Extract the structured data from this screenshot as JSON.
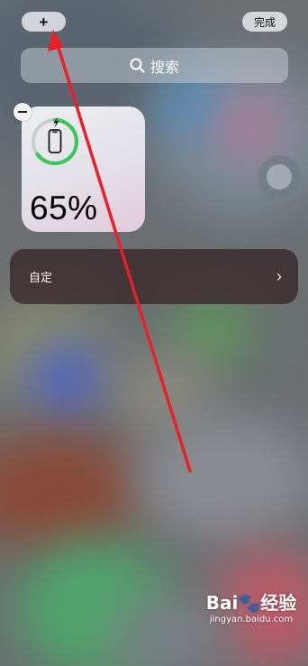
{
  "header": {
    "add_label": "+",
    "done_label": "完成"
  },
  "search": {
    "label": "搜索",
    "icon": "search-icon"
  },
  "battery_widget": {
    "percent_label": "65%",
    "level": 0.65,
    "ring_color": "#35c759",
    "icon": "iphone-icon",
    "charging_icon": "bolt-icon"
  },
  "customize_row": {
    "label": "自定",
    "icon": "chevron-right-icon"
  },
  "watermark": {
    "logo_text": "Bai🐾经验",
    "url": "jingyan.baidu.com"
  },
  "annotation": {
    "color": "#e8202a"
  }
}
